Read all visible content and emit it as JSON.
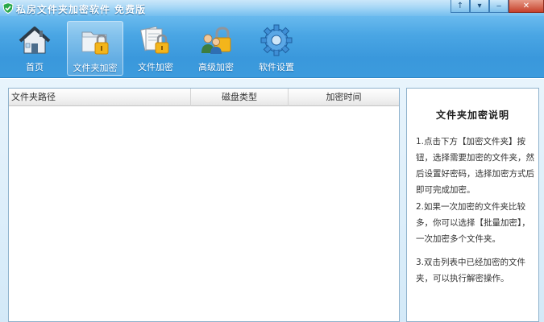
{
  "window": {
    "title": "私房文件夹加密软件 免费版",
    "controls": {
      "pin": "↑",
      "menu": "▾",
      "minimize": "‒",
      "close": "✕"
    }
  },
  "toolbar": {
    "items": [
      {
        "label": "首页",
        "icon": "home-icon"
      },
      {
        "label": "文件夹加密",
        "icon": "folder-lock-icon",
        "active": true
      },
      {
        "label": "文件加密",
        "icon": "file-lock-icon"
      },
      {
        "label": "高级加密",
        "icon": "users-lock-icon"
      },
      {
        "label": "软件设置",
        "icon": "gear-icon"
      }
    ]
  },
  "list": {
    "columns": {
      "path": "文件夹路径",
      "disk": "磁盘类型",
      "time": "加密时间"
    },
    "rows": []
  },
  "info": {
    "title": "文件夹加密说明",
    "items": [
      "1.点击下方【加密文件夹】按钮，选择需要加密的文件夹，然后设置好密码，选择加密方式后即可完成加密。",
      "2.如果一次加密的文件夹比较多，你可以选择【批量加密】，一次加密多个文件夹。",
      "3.双击列表中已经加密的文件夹，可以执行解密操作。"
    ]
  },
  "colors": {
    "header_top": "#9ed3f6",
    "header_bottom": "#3c9bdd",
    "body_bg": "#e8f4fc",
    "panel_border": "#8fb2cc"
  }
}
